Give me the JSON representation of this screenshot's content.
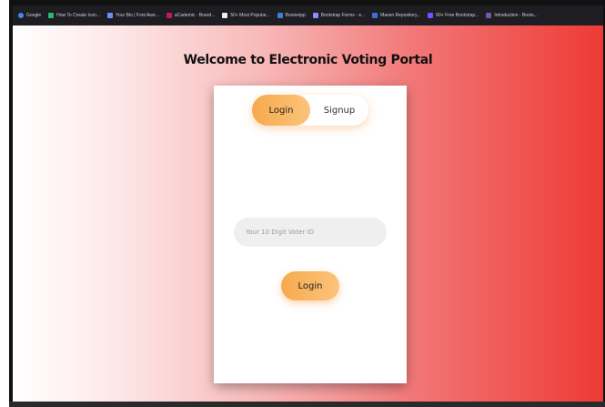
{
  "bookmarks": [
    {
      "label": "Google",
      "color": "#4285f4"
    },
    {
      "label": "How To Create Icon...",
      "color": "#2bb673"
    },
    {
      "label": "Your Bio | Font Awe...",
      "color": "#6c8cff"
    },
    {
      "label": "aCademic · Board...",
      "color": "#c2185b"
    },
    {
      "label": "50+ Most Popular...",
      "color": "#eeeeee"
    },
    {
      "label": "Bootsnipp",
      "color": "#3d7fd6"
    },
    {
      "label": "Bootstrap Forms · e...",
      "color": "#8a8fff"
    },
    {
      "label": "Maven Repository...",
      "color": "#3b6fd8"
    },
    {
      "label": "60+ Free Bootstrap...",
      "color": "#7c4dff"
    },
    {
      "label": "Introduction · Boots...",
      "color": "#7952b3"
    }
  ],
  "page": {
    "title": "Welcome to Electronic Voting Portal"
  },
  "tabs": {
    "login": "Login",
    "signup": "Signup"
  },
  "form": {
    "voter_id_placeholder": "Your 10 Digit Voter ID",
    "voter_id_value": "",
    "submit_label": "Login"
  },
  "colors": {
    "accent": "#f7a94f",
    "gradient_start": "#ffffff",
    "gradient_end": "#ee3a35"
  }
}
